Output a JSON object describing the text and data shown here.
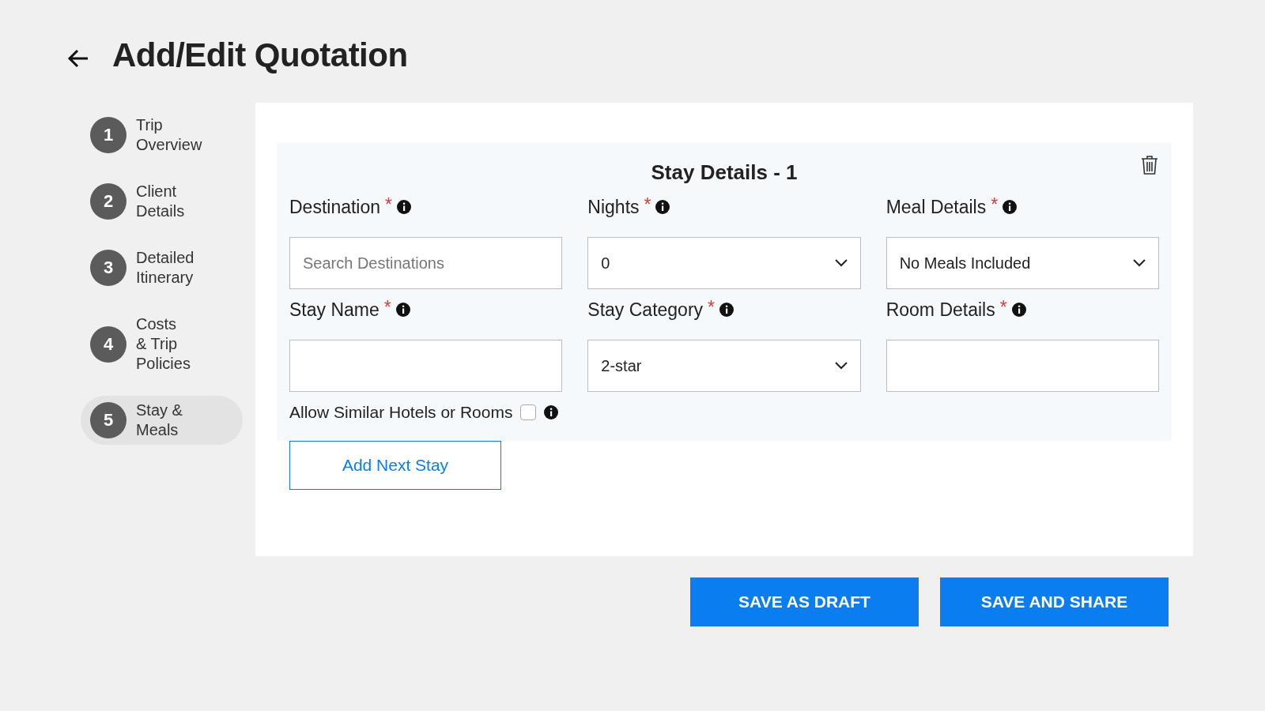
{
  "page": {
    "title": "Add/Edit Quotation"
  },
  "steps": [
    {
      "number": "1",
      "label": "Trip\nOverview",
      "selected": false
    },
    {
      "number": "2",
      "label": "Client\nDetails",
      "selected": false
    },
    {
      "number": "3",
      "label": "Detailed\nItinerary",
      "selected": false
    },
    {
      "number": "4",
      "label": "Costs\n& Trip\nPolicies",
      "selected": false
    },
    {
      "number": "5",
      "label": "Stay &\nMeals",
      "selected": true
    }
  ],
  "stay": {
    "title": "Stay Details - 1",
    "fields": [
      {
        "label": "Destination",
        "required_mark": "*",
        "kind": "text",
        "placeholder": "Search Destinations"
      },
      {
        "label": "Nights",
        "required_mark": "*",
        "kind": "select",
        "value": "0"
      },
      {
        "label": "Meal Details",
        "required_mark": "*",
        "kind": "select",
        "value": "No Meals Included"
      },
      {
        "label": "Stay Name",
        "required_mark": "*",
        "kind": "text"
      },
      {
        "label": "Stay Category",
        "required_mark": "*",
        "kind": "select",
        "value": "2-star"
      },
      {
        "label": "Room Details",
        "required_mark": "*",
        "kind": "text"
      }
    ],
    "similar": {
      "label": "Allow Similar Hotels or Rooms",
      "checked": false
    }
  },
  "add_button": "Add Next Stay",
  "actions": [
    "SAVE AS DRAFT",
    "SAVE AND SHARE"
  ]
}
